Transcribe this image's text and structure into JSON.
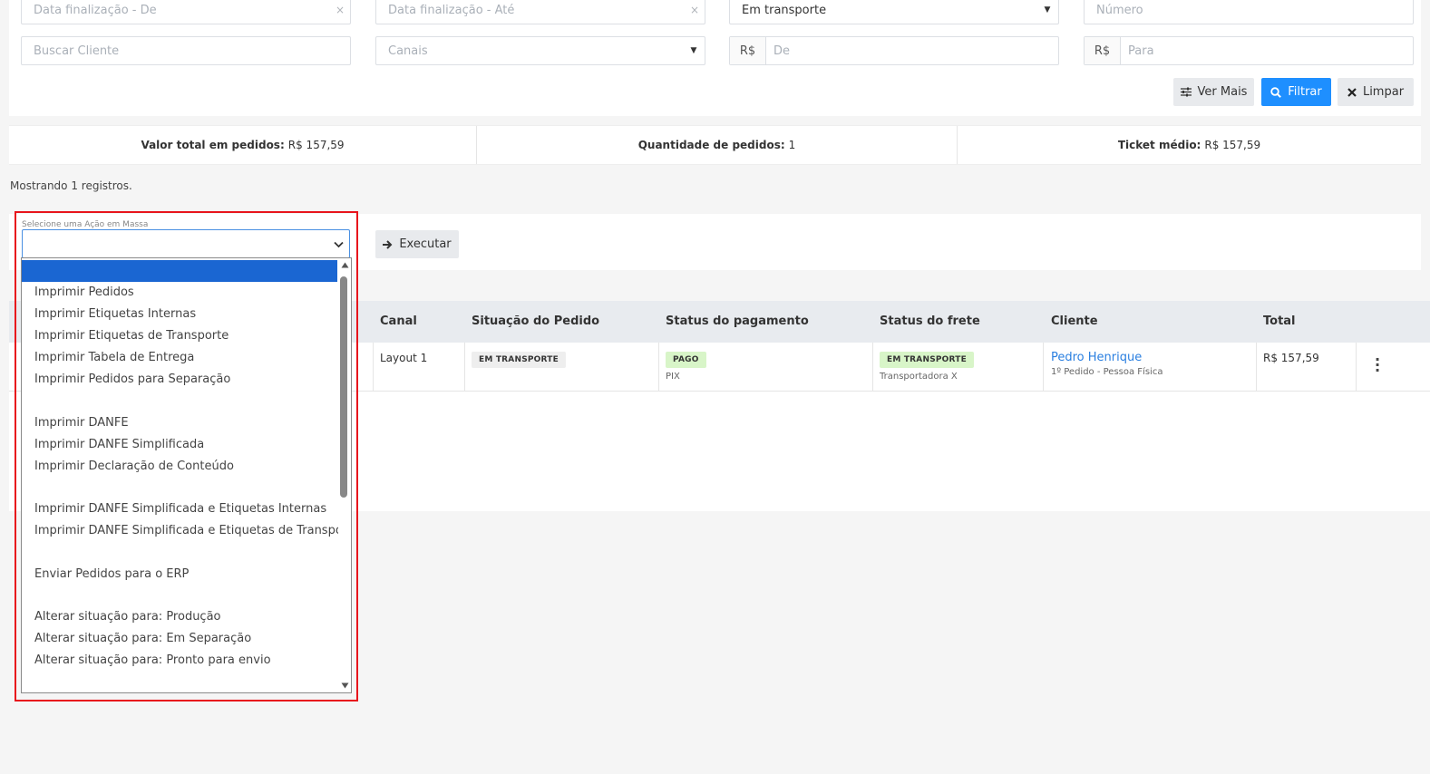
{
  "filters": {
    "date_from_placeholder": "Data finalização - De",
    "date_to_placeholder": "Data finalização - Até",
    "status_value": "Em transporte",
    "number_placeholder": "Número",
    "client_placeholder": "Buscar Cliente",
    "channels_placeholder": "Canais",
    "currency_prefix": "R$",
    "value_from_placeholder": "De",
    "value_to_placeholder": "Para",
    "clear_icon": "×",
    "caret_icon": "▼"
  },
  "actions": {
    "see_more_label": "Ver Mais",
    "filter_label": "Filtrar",
    "clear_label": "Limpar"
  },
  "summary": {
    "total_label": "Valor total em pedidos:",
    "total_value": "R$ 157,59",
    "count_label": "Quantidade de pedidos:",
    "count_value": "1",
    "ticket_label": "Ticket médio:",
    "ticket_value": "R$ 157,59"
  },
  "records_text": "Mostrando 1 registros.",
  "mass_action": {
    "label": "Selecione uma Ação em Massa",
    "execute_label": "Executar",
    "options": [
      "Imprimir Pedidos",
      "Imprimir Etiquetas Internas",
      "Imprimir Etiquetas de Transporte",
      "Imprimir Tabela de Entrega",
      "Imprimir Pedidos para Separação",
      "Imprimir DANFE",
      "Imprimir DANFE Simplificada",
      "Imprimir Declaração de Conteúdo",
      "Imprimir DANFE Simplificada e Etiquetas Internas",
      "Imprimir DANFE Simplificada e Etiquetas de Transporte",
      "Enviar Pedidos para o ERP",
      "Alterar situação para: Produção",
      "Alterar situação para: Em Separação",
      "Alterar situação para: Pronto para envio"
    ]
  },
  "table": {
    "headers": {
      "channel": "Canal",
      "order_status": "Situação do Pedido",
      "payment_status": "Status do pagamento",
      "shipping_status": "Status do frete",
      "client": "Cliente",
      "total": "Total"
    },
    "row": {
      "channel": "Layout 1",
      "order_status": "EM TRANSPORTE",
      "payment_status": "PAGO",
      "payment_method": "PIX",
      "shipping_status": "EM TRANSPORTE",
      "carrier": "Transportadora X",
      "client_name": "Pedro Henrique",
      "client_sub": "1º Pedido - Pessoa Física",
      "total": "R$ 157,59"
    }
  },
  "colors": {
    "primary": "#1e8fff",
    "highlight": "#e8141c",
    "dropdown_selected": "#1a66d2",
    "badge_green": "#d8f5c8",
    "link": "#2a7fe0"
  }
}
